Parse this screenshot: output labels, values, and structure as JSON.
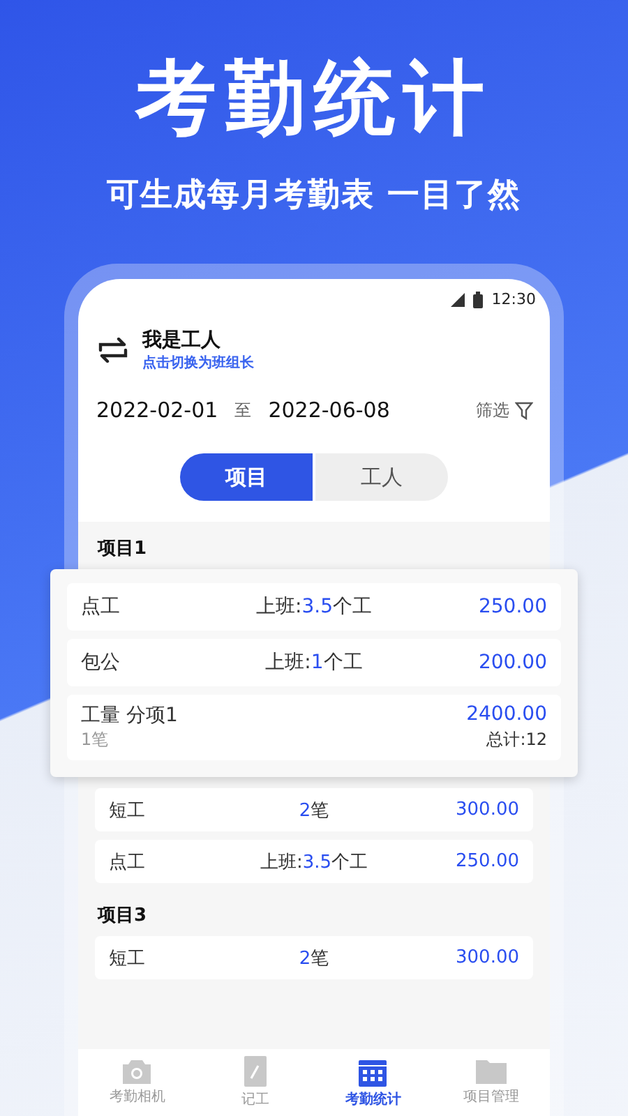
{
  "banner": {
    "title": "考勤统计",
    "subtitle": "可生成每月考勤表 一目了然"
  },
  "status_bar": {
    "time": "12:30"
  },
  "user": {
    "role": "我是工人",
    "switch_link": "点击切换为班组长"
  },
  "date_range": {
    "start": "2022-02-01",
    "separator": "至",
    "end": "2022-06-08",
    "filter": "筛选"
  },
  "tabs": [
    {
      "label": "项目",
      "selected": true
    },
    {
      "label": "工人",
      "selected": false
    }
  ],
  "groups": [
    {
      "title": "项目1",
      "elevated": true,
      "rows": [
        {
          "kind": "simple",
          "name": "点工",
          "middle": {
            "prefix": "上班:",
            "value": "3.5",
            "suffix": "个工"
          },
          "amount": "250.00"
        },
        {
          "kind": "simple",
          "name": "包公",
          "middle": {
            "prefix": "上班:",
            "value": "1",
            "suffix": "个工"
          },
          "amount": "200.00"
        },
        {
          "kind": "detail",
          "name": "工量 分项1",
          "amount": "2400.00",
          "note": "1笔",
          "total": "总计:12"
        }
      ]
    },
    {
      "elevated": false,
      "rows": [
        {
          "kind": "simple",
          "name": "短工",
          "middle": {
            "value": "2",
            "suffix": "笔"
          },
          "amount": "300.00"
        },
        {
          "kind": "simple",
          "name": "点工",
          "middle": {
            "prefix": "上班:",
            "value": "3.5",
            "suffix": "个工"
          },
          "amount": "250.00"
        }
      ]
    },
    {
      "title": "项目3",
      "elevated": false,
      "rows": [
        {
          "kind": "simple",
          "name": "短工",
          "middle": {
            "value": "2",
            "suffix": "笔"
          },
          "amount": "300.00"
        }
      ]
    }
  ],
  "bottom_nav": [
    {
      "label": "考勤相机",
      "selected": false
    },
    {
      "label": "记工",
      "selected": false
    },
    {
      "label": "考勤统计",
      "selected": true
    },
    {
      "label": "项目管理",
      "selected": false
    }
  ]
}
